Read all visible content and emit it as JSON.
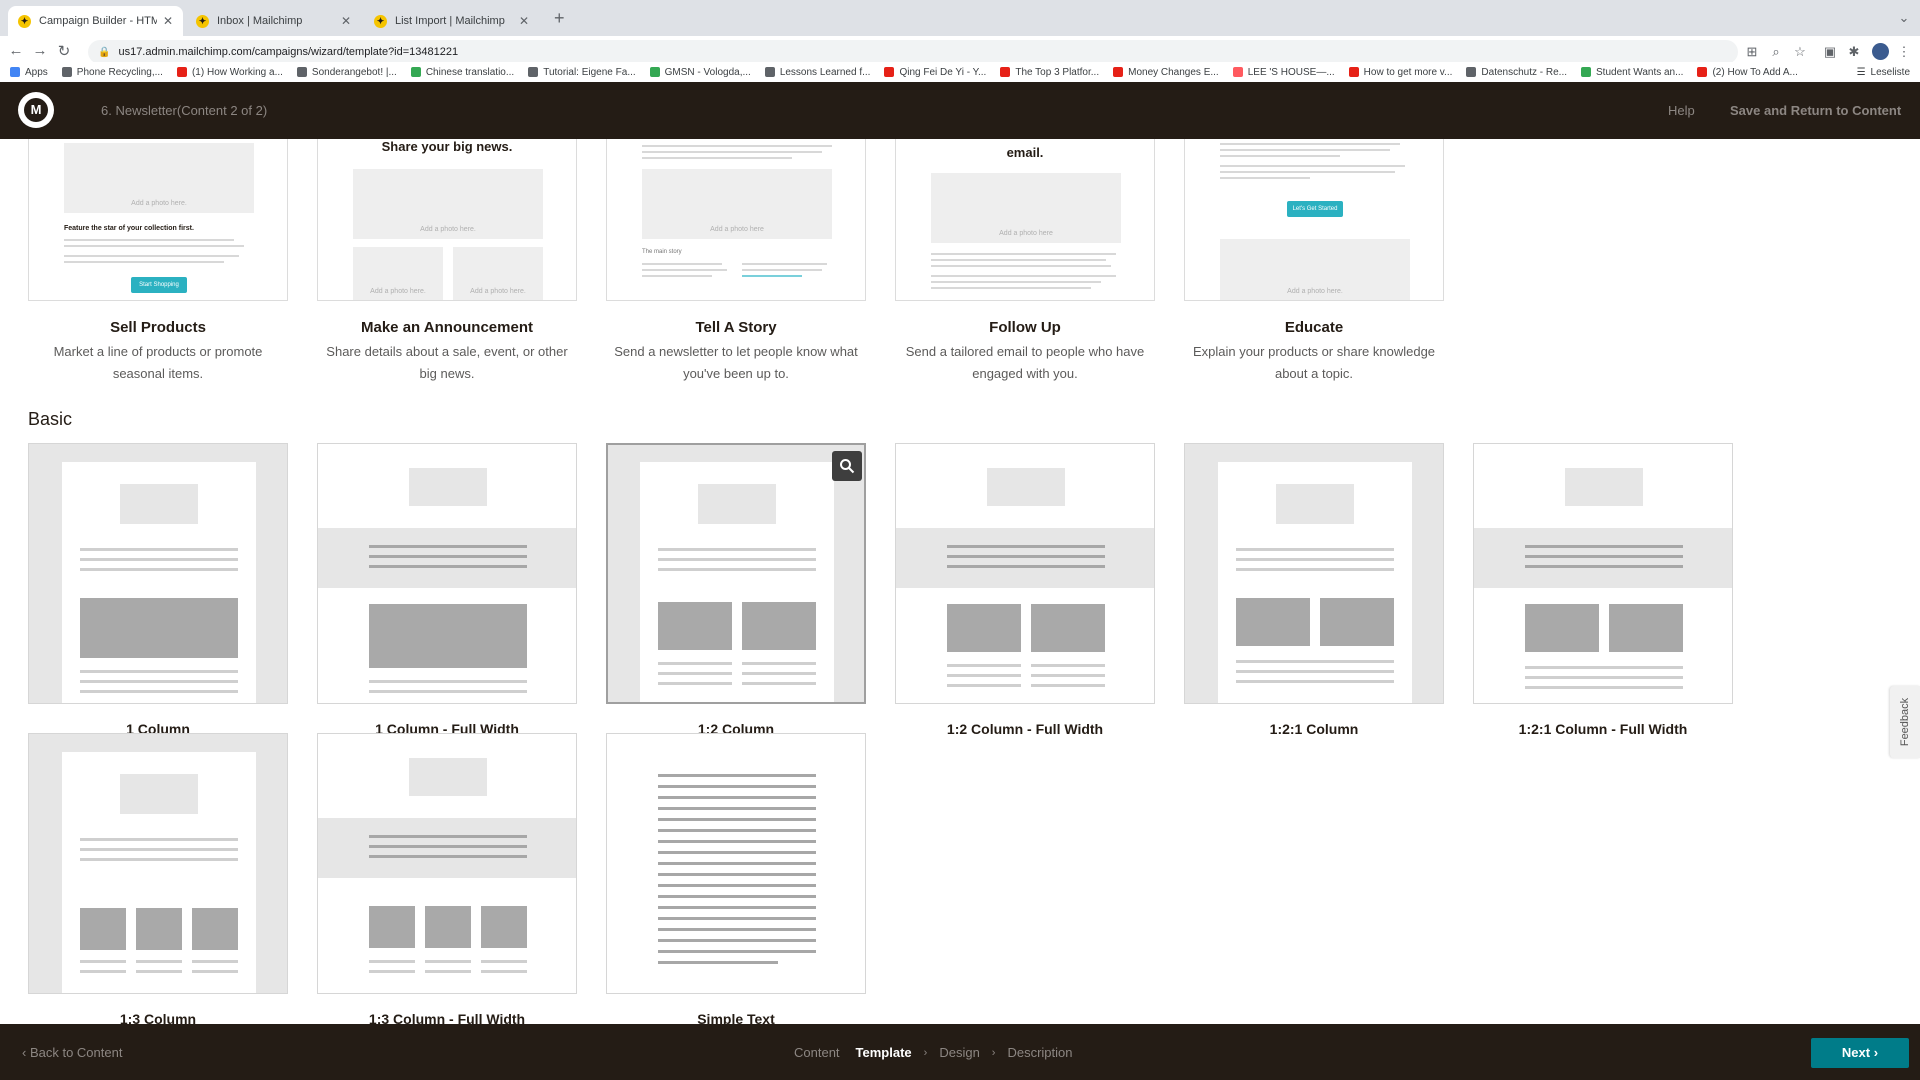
{
  "browser": {
    "tabs": [
      {
        "title": "Campaign Builder - HTML | M",
        "active": true
      },
      {
        "title": "Inbox | Mailchimp",
        "active": false
      },
      {
        "title": "List Import | Mailchimp",
        "active": false
      }
    ],
    "url": "us17.admin.mailchimp.com/campaigns/wizard/template?id=13481221",
    "bookmarks": [
      {
        "label": "Apps",
        "color": "#4285f4"
      },
      {
        "label": "Phone Recycling,...",
        "color": "#5f6368"
      },
      {
        "label": "(1) How Working a...",
        "color": "#e62117"
      },
      {
        "label": "Sonderangebot! |...",
        "color": "#5f6368"
      },
      {
        "label": "Chinese translatio...",
        "color": "#34a853"
      },
      {
        "label": "Tutorial: Eigene Fa...",
        "color": "#5f6368"
      },
      {
        "label": "GMSN - Vologda,...",
        "color": "#34a853"
      },
      {
        "label": "Lessons Learned f...",
        "color": "#5f6368"
      },
      {
        "label": "Qing Fei De Yi - Y...",
        "color": "#e62117"
      },
      {
        "label": "The Top 3 Platfor...",
        "color": "#e62117"
      },
      {
        "label": "Money Changes E...",
        "color": "#e62117"
      },
      {
        "label": "LEE 'S HOUSE—...",
        "color": "#ff5a5f"
      },
      {
        "label": "How to get more v...",
        "color": "#e62117"
      },
      {
        "label": "Datenschutz - Re...",
        "color": "#5f6368"
      },
      {
        "label": "Student Wants an...",
        "color": "#34a853"
      },
      {
        "label": "(2) How To Add A...",
        "color": "#e62117"
      }
    ],
    "reading_list": "Leseliste"
  },
  "header": {
    "logo_letter": "M",
    "campaign_title": "6. Newsletter(Content 2 of 2)",
    "help": "Help",
    "save_return": "Save and Return to Content"
  },
  "featured": [
    {
      "name": "Sell Products",
      "desc": "Market a line of products or promote seasonal items.",
      "preview_heading": "Feature the star of your collection first.",
      "preview_photo": "Add a photo here.",
      "preview_button": "Start Shopping"
    },
    {
      "name": "Make an Announcement",
      "desc": "Share details about a sale, event, or other big news.",
      "preview_heading": "Share your big news.",
      "preview_photo": "Add a photo here.",
      "preview_photo_small": "Add a photo here."
    },
    {
      "name": "Tell A Story",
      "desc": "Send a newsletter to let people know what you've been up to.",
      "preview_photo": "Add a photo here",
      "preview_subhead": "The main story"
    },
    {
      "name": "Follow Up",
      "desc": "Send a tailored email to people who have engaged with you.",
      "preview_heading": "email.",
      "preview_photo": "Add a photo here"
    },
    {
      "name": "Educate",
      "desc": "Explain your products or share knowledge about a topic.",
      "preview_photo": "Add a photo here.",
      "preview_button": "Let's Get Started"
    }
  ],
  "basic": {
    "title": "Basic",
    "templates": [
      {
        "name": "1 Column"
      },
      {
        "name": "1 Column - Full Width"
      },
      {
        "name": "1:2 Column"
      },
      {
        "name": "1:2 Column - Full Width"
      },
      {
        "name": "1:2:1 Column"
      },
      {
        "name": "1:2:1 Column - Full Width"
      },
      {
        "name": "1:3 Column"
      },
      {
        "name": "1:3 Column - Full Width"
      },
      {
        "name": "Simple Text"
      }
    ]
  },
  "feedback": "Feedback",
  "footer": {
    "back": "Back to Content",
    "steps": [
      "Content",
      "Template",
      "Design",
      "Description"
    ],
    "current_step": "Template",
    "next": "Next"
  },
  "colors": {
    "header_bg": "#241c15",
    "accent_teal": "#007c89",
    "preview_button": "#2bb1c1"
  }
}
